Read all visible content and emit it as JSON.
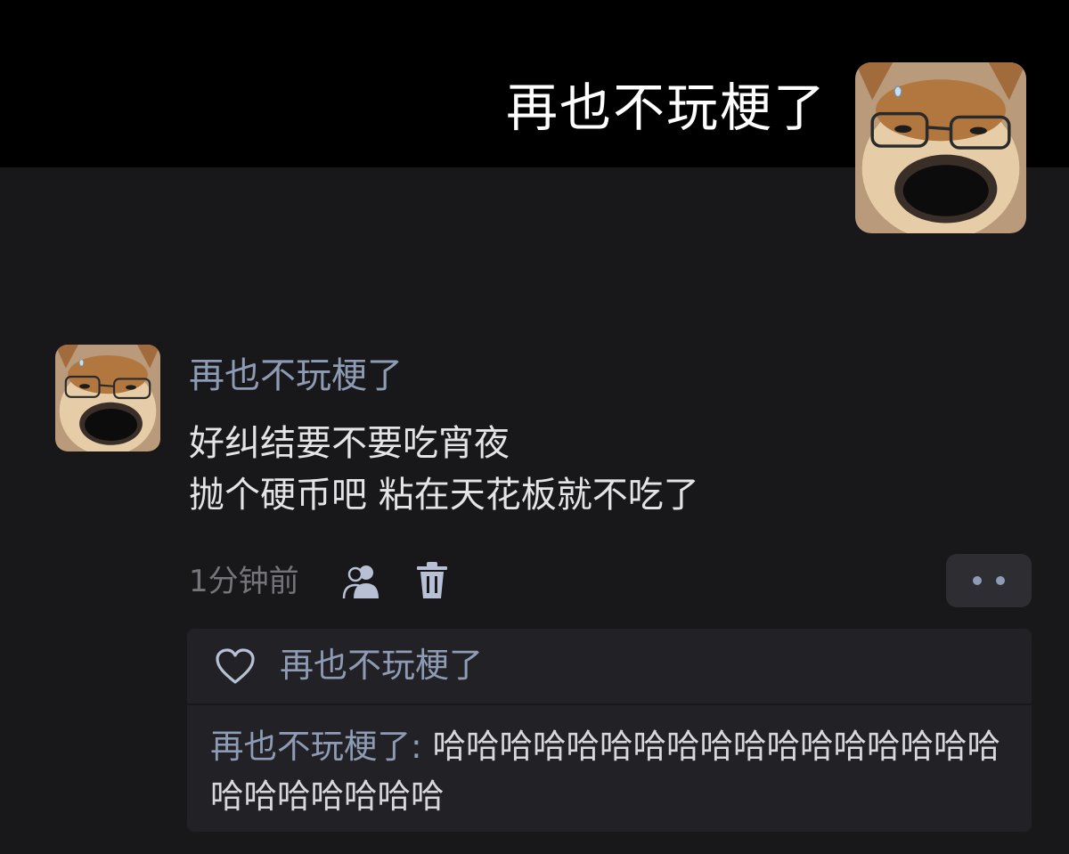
{
  "header": {
    "title": "再也不玩梗了",
    "avatar_icon": "shiba-glasses-avatar"
  },
  "comment": {
    "avatar_icon": "shiba-glasses-avatar",
    "username": "再也不玩梗了",
    "lines": [
      "好纠结要不要吃宵夜",
      "抛个硬币吧 粘在天花板就不吃了"
    ],
    "time": "1分钟前",
    "icons": {
      "visibility": "people-icon",
      "delete": "trash-icon",
      "more": "more-dots-icon"
    }
  },
  "reply_box": {
    "like_icon": "heart-icon",
    "liker": "再也不玩梗了",
    "reply_author": "再也不玩梗了:",
    "reply_text": " 哈哈哈哈哈哈哈哈哈哈哈哈哈哈哈哈哈哈哈哈哈哈哈哈"
  },
  "colors": {
    "background": "#18181a",
    "top_band": "#000000",
    "accent_name": "#8e9bb5",
    "text": "#e4e4e6",
    "muted": "#74747a",
    "panel": "#222226"
  }
}
